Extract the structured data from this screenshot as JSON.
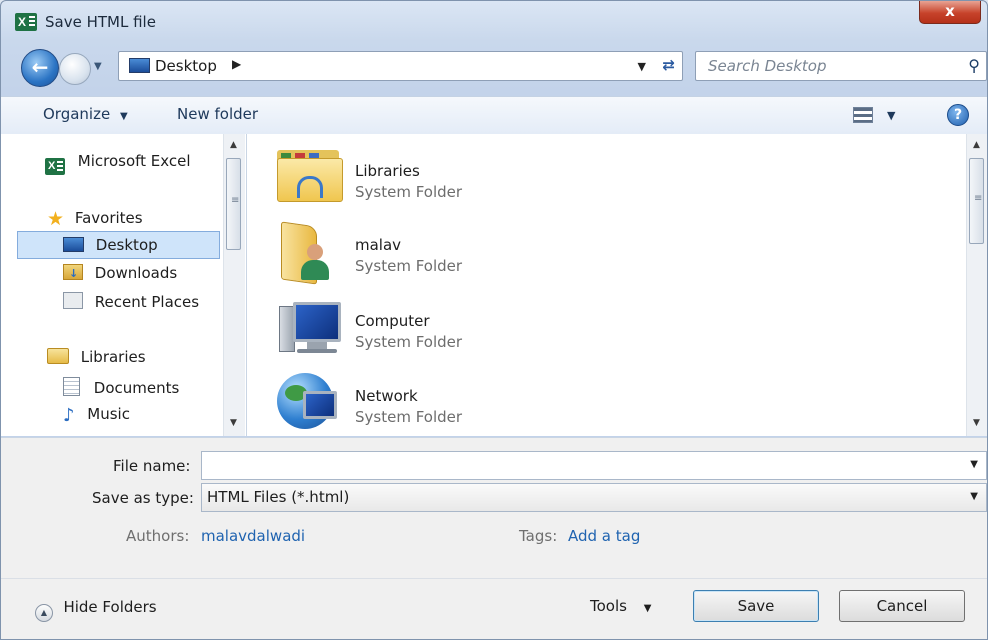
{
  "window": {
    "title": "Save HTML file",
    "app_badge": "X",
    "close_glyph": "x"
  },
  "nav": {
    "address_location": "Desktop",
    "search_placeholder": "Search Desktop"
  },
  "toolbar": {
    "organize_label": "Organize",
    "new_folder_label": "New folder"
  },
  "sidebar": {
    "items": [
      {
        "label": "Microsoft Excel",
        "icon": "excel-icon"
      },
      {
        "label": "Favorites",
        "icon": "star-icon"
      },
      {
        "label": "Desktop",
        "icon": "desktop-icon",
        "selected": true
      },
      {
        "label": "Downloads",
        "icon": "downloads-icon"
      },
      {
        "label": "Recent Places",
        "icon": "recent-places-icon"
      },
      {
        "label": "Libraries",
        "icon": "libraries-icon"
      },
      {
        "label": "Documents",
        "icon": "documents-icon"
      },
      {
        "label": "Music",
        "icon": "music-icon"
      }
    ]
  },
  "files": [
    {
      "name": "Libraries",
      "type": "System Folder",
      "icon": "libraries-folder-icon"
    },
    {
      "name": "malav",
      "type": "System Folder",
      "icon": "user-folder-icon"
    },
    {
      "name": "Computer",
      "type": "System Folder",
      "icon": "computer-icon"
    },
    {
      "name": "Network",
      "type": "System Folder",
      "icon": "network-icon"
    }
  ],
  "form": {
    "file_name_label": "File name:",
    "file_name_value": "",
    "save_type_label": "Save as type:",
    "save_type_value": "HTML Files (*.html)",
    "authors_label": "Authors:",
    "authors_value": "malavdalwadi",
    "tags_label": "Tags:",
    "tags_value": "Add a tag"
  },
  "footer": {
    "hide_folders_label": "Hide Folders",
    "tools_label": "Tools",
    "save_label": "Save",
    "cancel_label": "Cancel"
  },
  "colors": {
    "accent": "#1f63b0",
    "selection": "#cfe4fa",
    "close": "#c7432b"
  }
}
